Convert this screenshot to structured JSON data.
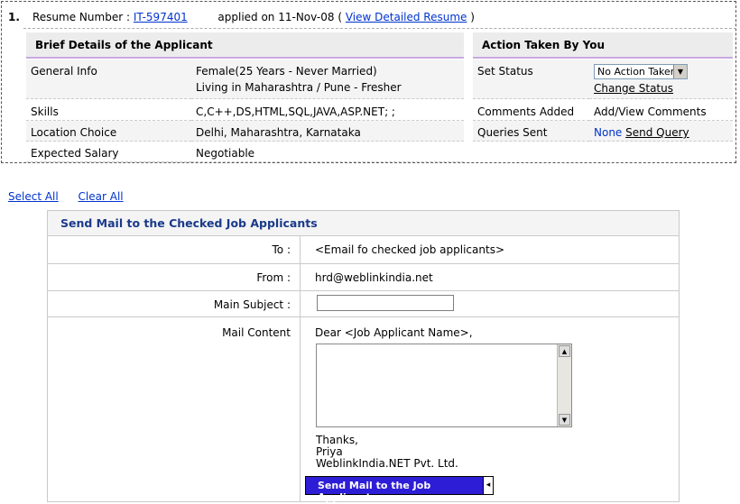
{
  "resume": {
    "index": "1.",
    "number_label": "Resume Number :",
    "number_value": "IT-597401",
    "applied_text": "applied on 11-Nov-08 (",
    "view_link": "View Detailed Resume",
    "close_paren": ")"
  },
  "brief": {
    "header": "Brief Details of the Applicant",
    "rows": [
      {
        "label": "General Info",
        "value1": "Female(25 Years - Never Married)",
        "value2": "Living in Maharashtra / Pune - Fresher"
      },
      {
        "label": "Skills",
        "value1": "C,C++,DS,HTML,SQL,JAVA,ASP.NET; ;"
      },
      {
        "label": "Location Choice",
        "value1": "Delhi, Maharashtra, Karnataka"
      },
      {
        "label": "Expected Salary",
        "value1": "Negotiable"
      }
    ]
  },
  "action": {
    "header": "Action Taken By You",
    "set_status_label": "Set Status",
    "status_selected": "No Action Taken",
    "change_status": "Change Status",
    "comments_label": "Comments Added",
    "comments_value": "Add/View Comments",
    "queries_label": "Queries Sent",
    "queries_none": "None",
    "send_query": "Send Query"
  },
  "select_links": {
    "select_all": "Select All",
    "clear_all": "Clear All"
  },
  "mail": {
    "title": "Send Mail to the Checked Job Applicants",
    "to_label": "To :",
    "to_value": "<Email fo checked job applicants>",
    "from_label": "From :",
    "from_value": "hrd@weblinkindia.net",
    "subject_label": "Main Subject :",
    "content_label": "Mail Content",
    "greeting": "Dear <Job Applicant Name>,",
    "sign1": "Thanks,",
    "sign2": "Priya",
    "sign3": "WeblinkIndia.NET Pvt. Ltd.",
    "send_button": "Send Mail to the Job Applicants"
  }
}
